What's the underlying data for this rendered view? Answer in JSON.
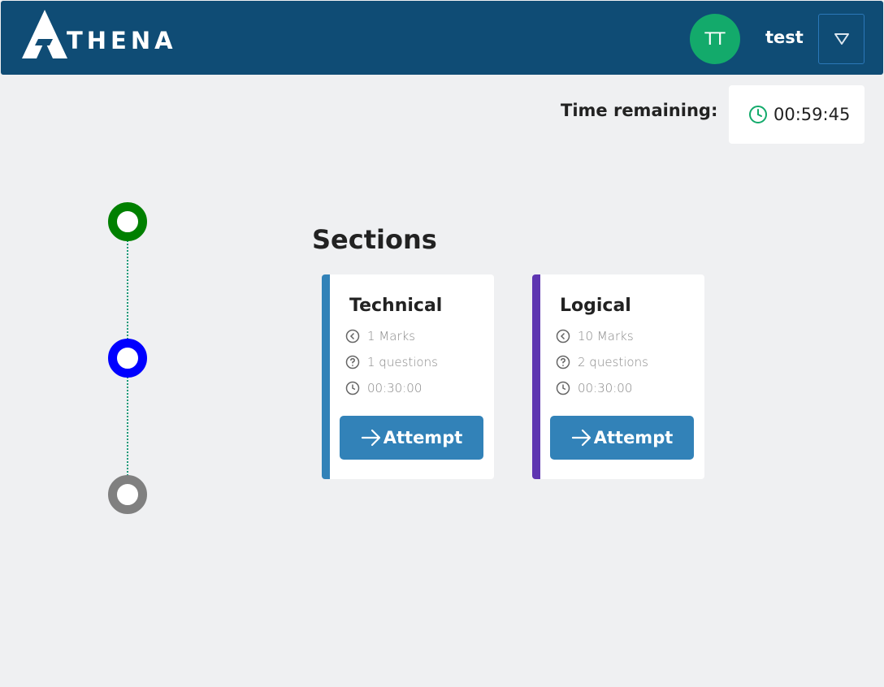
{
  "header": {
    "logo_text": "THENA",
    "avatar_initials": "TT",
    "username": "test",
    "dropdown_icon": "triangle-down-icon"
  },
  "timer": {
    "label": "Time remaining:",
    "value": "00:59:45",
    "icon": "clock-icon",
    "icon_color": "#13aa6b"
  },
  "stepper": {
    "steps": [
      {
        "status": "completed",
        "color": "#008000"
      },
      {
        "status": "current",
        "color": "#0000ff"
      },
      {
        "status": "pending",
        "color": "#808080"
      }
    ]
  },
  "main": {
    "title": "Sections",
    "sections": [
      {
        "name": "Technical",
        "accent_color": "#3282b8",
        "marks": "1 Marks",
        "questions": "1 questions",
        "duration": "00:30:00",
        "button_label": "Attempt"
      },
      {
        "name": "Logical",
        "accent_color": "#5e35b1",
        "marks": "10 Marks",
        "questions": "2 questions",
        "duration": "00:30:00",
        "button_label": "Attempt"
      }
    ]
  },
  "colors": {
    "topbar": "#0f4c75",
    "background": "#eff0f2",
    "button": "#3282b8",
    "avatar": "#13aa6b"
  }
}
